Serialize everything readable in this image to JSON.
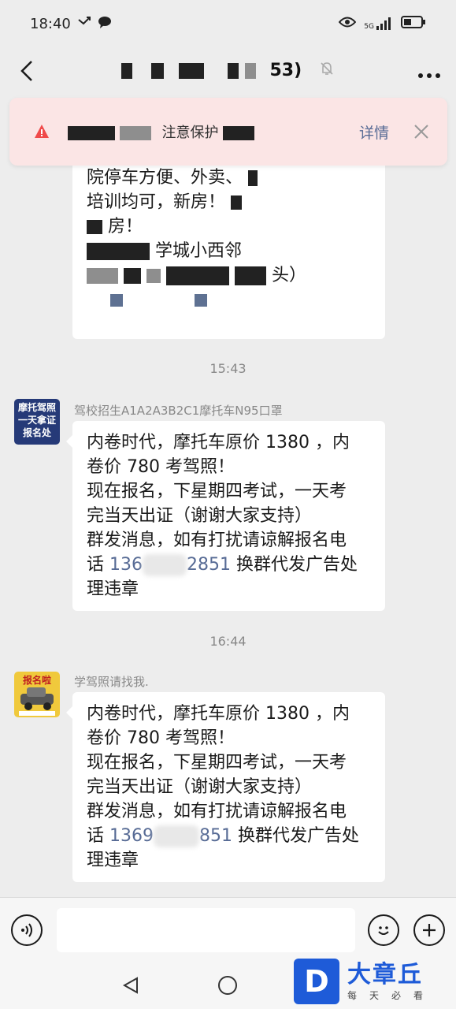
{
  "status": {
    "time": "18:40",
    "network": "5G"
  },
  "header": {
    "title_suffix": "53)"
  },
  "notice": {
    "text": "注意保护",
    "detail_label": "详情"
  },
  "first_message": {
    "line1": "院停车方便、外卖、",
    "line2": "培训均可，新房！",
    "line3": "房！",
    "line4": "学城小西邻",
    "line5": "头）"
  },
  "messages": [
    {
      "time": "15:43",
      "sender": "驾校招生A1A2A3B2C1摩托车N95口罩",
      "avatar_text": [
        "摩托驾照",
        "一天拿证",
        "报名处"
      ],
      "lines": [
        "内卷时代，摩托车原价 1380 ，内",
        "卷价 780 考驾照！",
        "现在报名，下星期四考试，一天考",
        "完当天出证（谢谢大家支持）",
        "群发消息，如有打扰请谅解报名电"
      ],
      "phone_prefix": "话 ",
      "phone_visible_start": "136",
      "phone_visible_end": "2851",
      "after_phone": " 换群代发广告处",
      "last_line": "理违章"
    },
    {
      "time": "16:44",
      "sender": "学驾照请找我.",
      "avatar_text": [
        "报名啦"
      ],
      "lines": [
        "内卷时代，摩托车原价 1380 ，内",
        "卷价 780 考驾照！",
        "现在报名，下星期四考试，一天考",
        "完当天出证（谢谢大家支持）",
        "群发消息，如有打扰请谅解报名电"
      ],
      "phone_prefix": "话 ",
      "phone_visible_start": "1369",
      "phone_visible_end": "851",
      "after_phone": " 换群代发广告处",
      "last_line": "理违章"
    }
  ],
  "brand": {
    "name": "大章丘",
    "sub": "每天必看",
    "logo": "D"
  }
}
